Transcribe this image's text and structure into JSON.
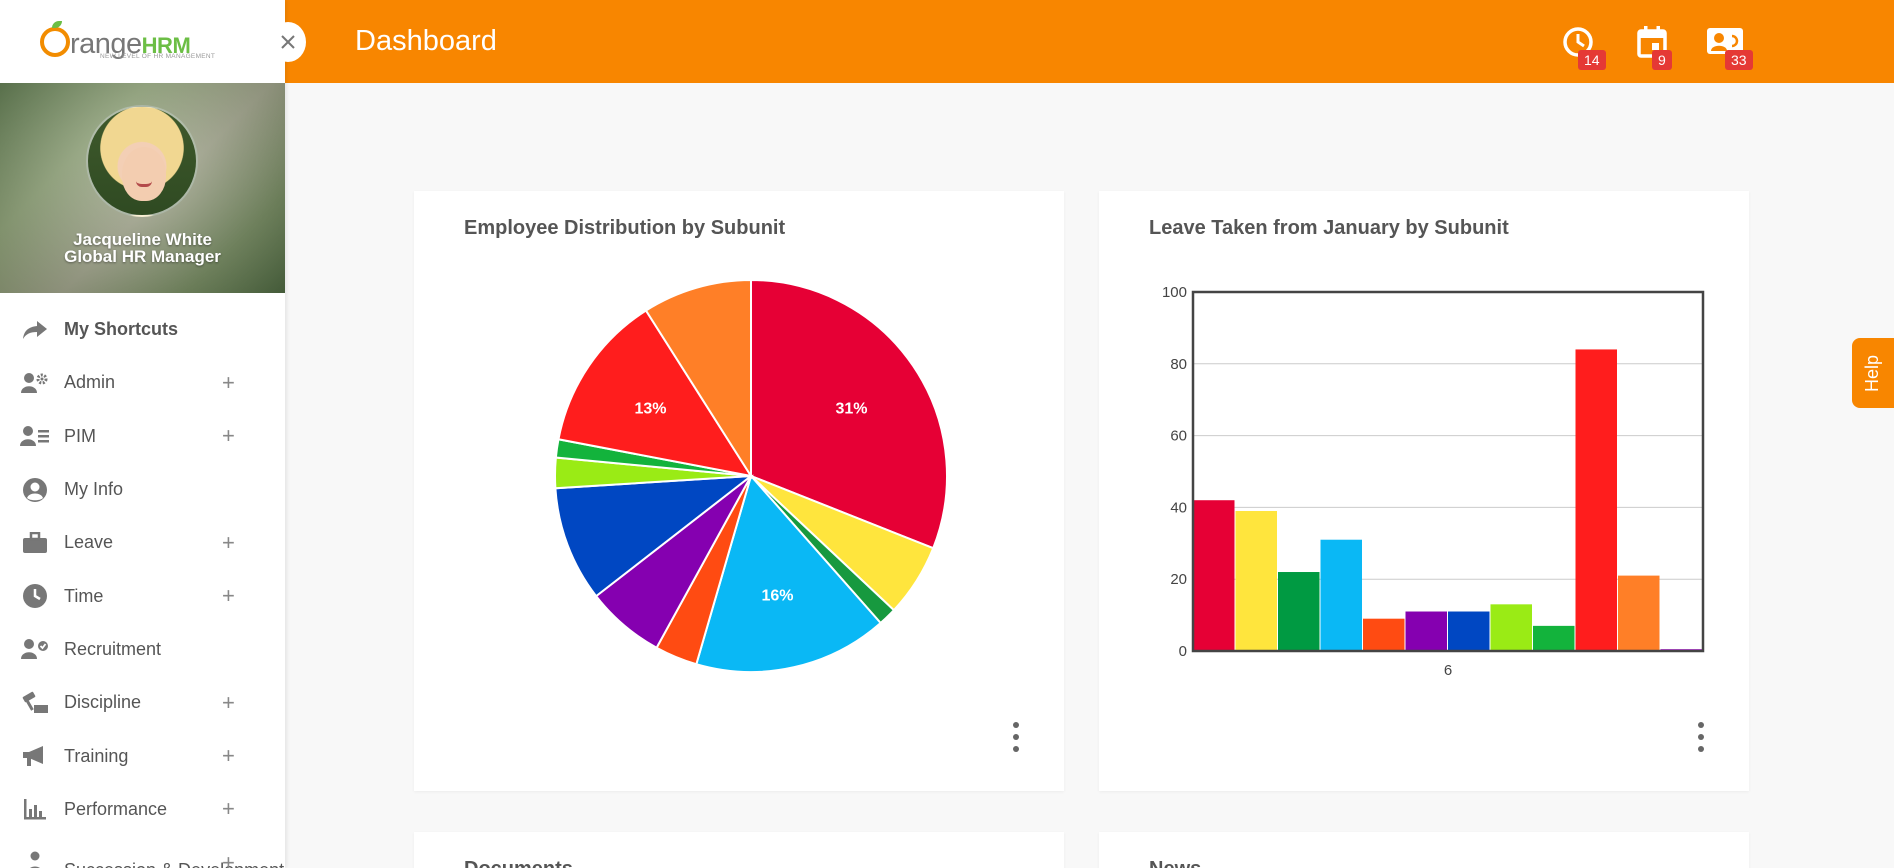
{
  "app": {
    "logo_text": "range",
    "logo_hrm": "HRM",
    "logo_tagline": "NEW LEVEL OF HR MANAGEMENT"
  },
  "profile": {
    "name": "Jacqueline White",
    "role": "Global HR Manager"
  },
  "sidebar": {
    "items": [
      {
        "label": "My Shortcuts",
        "icon": "share-arrow-icon",
        "expandable": false
      },
      {
        "label": "Admin",
        "icon": "admin-users-gear-icon",
        "expandable": true
      },
      {
        "label": "PIM",
        "icon": "pim-user-list-icon",
        "expandable": true
      },
      {
        "label": "My Info",
        "icon": "account-circle-icon",
        "expandable": false
      },
      {
        "label": "Leave",
        "icon": "briefcase-icon",
        "expandable": true
      },
      {
        "label": "Time",
        "icon": "clock-icon",
        "expandable": true
      },
      {
        "label": "Recruitment",
        "icon": "user-check-icon",
        "expandable": false
      },
      {
        "label": "Discipline",
        "icon": "discipline-hammer-icon",
        "expandable": true
      },
      {
        "label": "Training",
        "icon": "megaphone-icon",
        "expandable": true
      },
      {
        "label": "Performance",
        "icon": "bar-chart-icon",
        "expandable": true
      },
      {
        "label": "Succession & Development",
        "icon": "succession-icon",
        "expandable": true
      }
    ],
    "plus_symbol": "+"
  },
  "header": {
    "title": "Dashboard",
    "notifications": [
      {
        "icon": "clock-icon",
        "count": "14"
      },
      {
        "icon": "calendar-icon",
        "count": "9"
      },
      {
        "icon": "contact-card-icon",
        "count": "33"
      }
    ]
  },
  "help": {
    "label": "Help"
  },
  "cards": {
    "employee_distribution": {
      "title": "Employee Distribution by Subunit"
    },
    "leave_taken": {
      "title": "Leave Taken from January by Subunit"
    },
    "documents": {
      "title": "Documents"
    },
    "news": {
      "title": "News"
    }
  },
  "chart_data": [
    {
      "type": "pie",
      "title": "Employee Distribution by Subunit",
      "slices": [
        {
          "value": 31,
          "color": "#e60035",
          "label": "31%"
        },
        {
          "value": 6,
          "color": "#ffe53d",
          "label": ""
        },
        {
          "value": 1.5,
          "color": "#17993f",
          "label": ""
        },
        {
          "value": 16,
          "color": "#0ab8f5",
          "label": "16%"
        },
        {
          "value": 3.5,
          "color": "#ff4b12",
          "label": ""
        },
        {
          "value": 6.5,
          "color": "#8500b0",
          "label": ""
        },
        {
          "value": 9.5,
          "color": "#0047c2",
          "label": ""
        },
        {
          "value": 2.5,
          "color": "#9aeb15",
          "label": ""
        },
        {
          "value": 1.5,
          "color": "#13b33c",
          "label": ""
        },
        {
          "value": 13,
          "color": "#ff1d1d",
          "label": "13%"
        },
        {
          "value": 9,
          "color": "#ff7f27",
          "label": ""
        }
      ]
    },
    {
      "type": "bar",
      "title": "Leave Taken from January by Subunit",
      "categories": [
        "6"
      ],
      "series": [
        {
          "values": [
            42
          ],
          "color": "#e60035"
        },
        {
          "values": [
            39
          ],
          "color": "#ffe53d"
        },
        {
          "values": [
            22
          ],
          "color": "#009a42"
        },
        {
          "values": [
            31
          ],
          "color": "#0ab8f5"
        },
        {
          "values": [
            9
          ],
          "color": "#ff4b12"
        },
        {
          "values": [
            11
          ],
          "color": "#8500b0"
        },
        {
          "values": [
            11
          ],
          "color": "#0047c2"
        },
        {
          "values": [
            13
          ],
          "color": "#9aeb15"
        },
        {
          "values": [
            7
          ],
          "color": "#13b33c"
        },
        {
          "values": [
            84
          ],
          "color": "#ff1d1d"
        },
        {
          "values": [
            21
          ],
          "color": "#ff7f27"
        },
        {
          "values": [
            0.5
          ],
          "color": "#a000c8"
        }
      ],
      "ylim": [
        0,
        100
      ],
      "yticks": [
        0,
        20,
        40,
        60,
        80,
        100
      ],
      "grid": true
    }
  ]
}
